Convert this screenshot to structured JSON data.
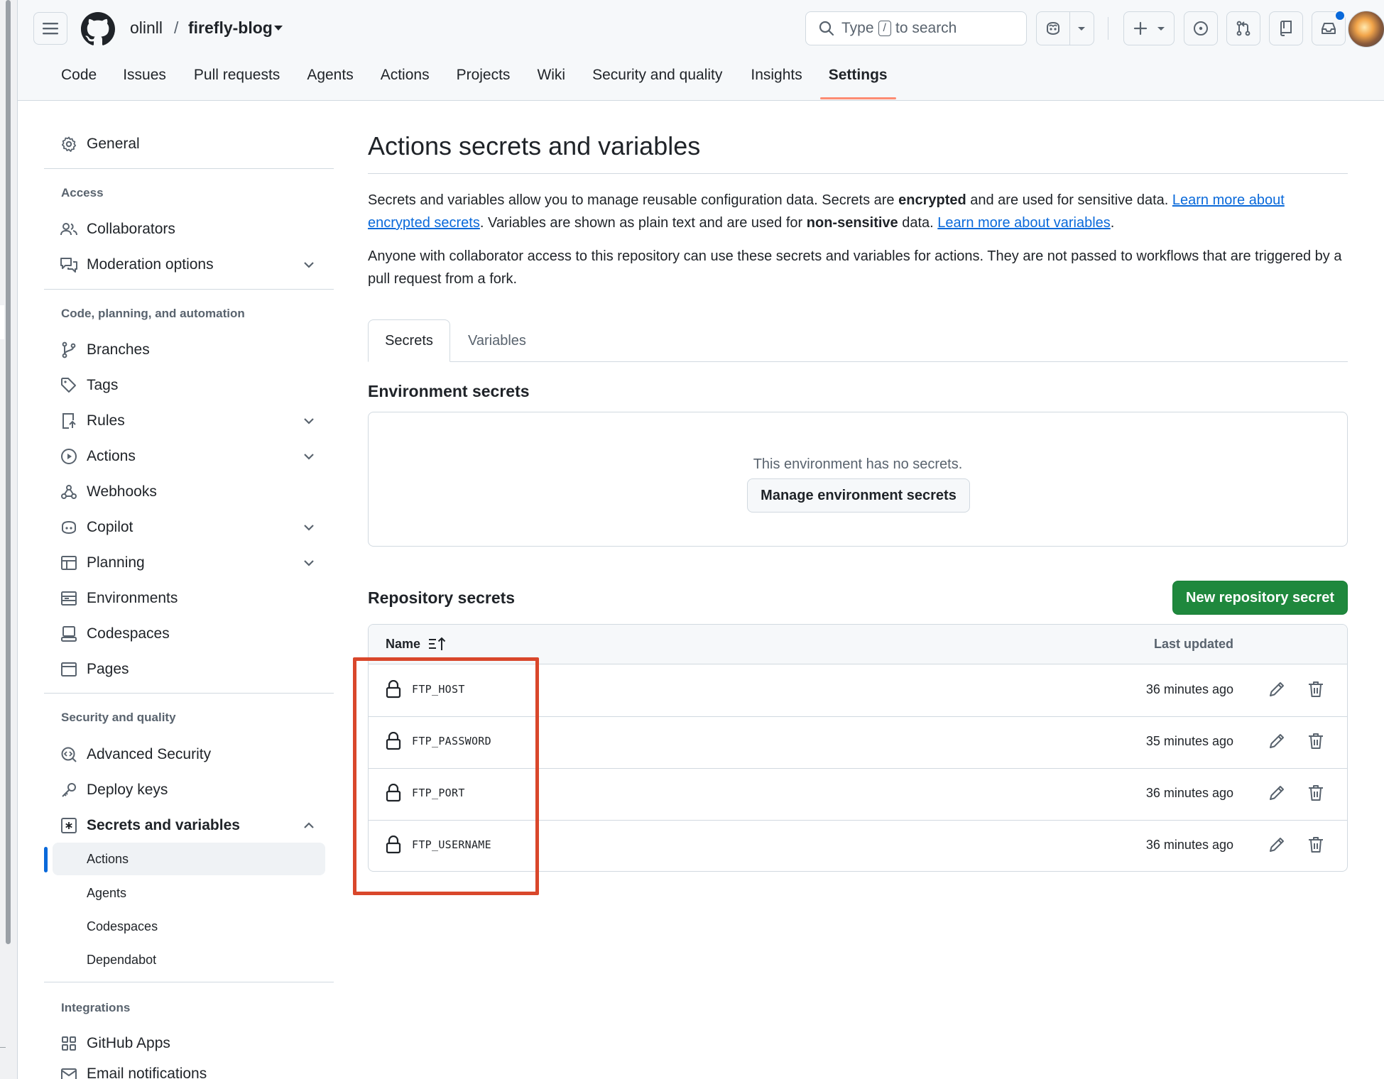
{
  "header": {
    "owner": "olinll",
    "slash": "/",
    "repo": "firefly-blog",
    "search": {
      "prefix": "Type",
      "key": "/",
      "suffix": "to search"
    },
    "icons": [
      "menu-icon",
      "github-logo-icon",
      "search-icon",
      "copilot-icon",
      "plus-icon",
      "issue-icon",
      "pull-request-icon",
      "repo-icon",
      "inbox-icon"
    ]
  },
  "repo_tabs": [
    "Code",
    "Issues",
    "Pull requests",
    "Agents",
    "Actions",
    "Projects",
    "Wiki",
    "Security and quality",
    "Insights",
    "Settings"
  ],
  "repo_tab_active": "Settings",
  "sidebar": {
    "general": "General",
    "access_heading": "Access",
    "collaborators": "Collaborators",
    "moderation": "Moderation options",
    "code_heading": "Code, planning, and automation",
    "branches": "Branches",
    "tags": "Tags",
    "rules": "Rules",
    "actions": "Actions",
    "webhooks": "Webhooks",
    "copilot": "Copilot",
    "planning": "Planning",
    "environments": "Environments",
    "codespaces": "Codespaces",
    "pages": "Pages",
    "security_heading": "Security and quality",
    "advanced_security": "Advanced Security",
    "deploy_keys": "Deploy keys",
    "secrets_vars": "Secrets and variables",
    "sub": [
      "Actions",
      "Agents",
      "Codespaces",
      "Dependabot"
    ],
    "sub_active": "Actions",
    "integrations_heading": "Integrations",
    "github_apps": "GitHub Apps",
    "email_notifications": "Email notifications"
  },
  "main": {
    "title": "Actions secrets and variables",
    "p1": {
      "a": "Secrets and variables allow you to manage reusable configuration data. Secrets are ",
      "b": "encrypted",
      "c": " and are used for sensitive data. ",
      "link1": "Learn more about encrypted secrets",
      "d": ". Variables are shown as plain text and are used for ",
      "e": "non-sensitive",
      "f": " data. ",
      "link2": "Learn more about variables",
      "g": "."
    },
    "p2": "Anyone with collaborator access to this repository can use these secrets and variables for actions. They are not passed to workflows that are triggered by a pull request from a fork.",
    "tabs": {
      "secrets": "Secrets",
      "variables": "Variables"
    },
    "env_heading": "Environment secrets",
    "env_empty": "This environment has no secrets.",
    "env_button": "Manage environment secrets",
    "repo_heading": "Repository secrets",
    "new_button": "New repository secret",
    "table": {
      "col_name": "Name",
      "col_updated": "Last updated",
      "rows": [
        {
          "name": "FTP_HOST",
          "updated": "36 minutes ago"
        },
        {
          "name": "FTP_PASSWORD",
          "updated": "35 minutes ago"
        },
        {
          "name": "FTP_PORT",
          "updated": "36 minutes ago"
        },
        {
          "name": "FTP_USERNAME",
          "updated": "36 minutes ago"
        }
      ]
    }
  },
  "colors": {
    "accent": "#0969da",
    "primary_button": "#1f883d",
    "tab_underline": "#fd8c73",
    "annotation": "#d9472b"
  }
}
